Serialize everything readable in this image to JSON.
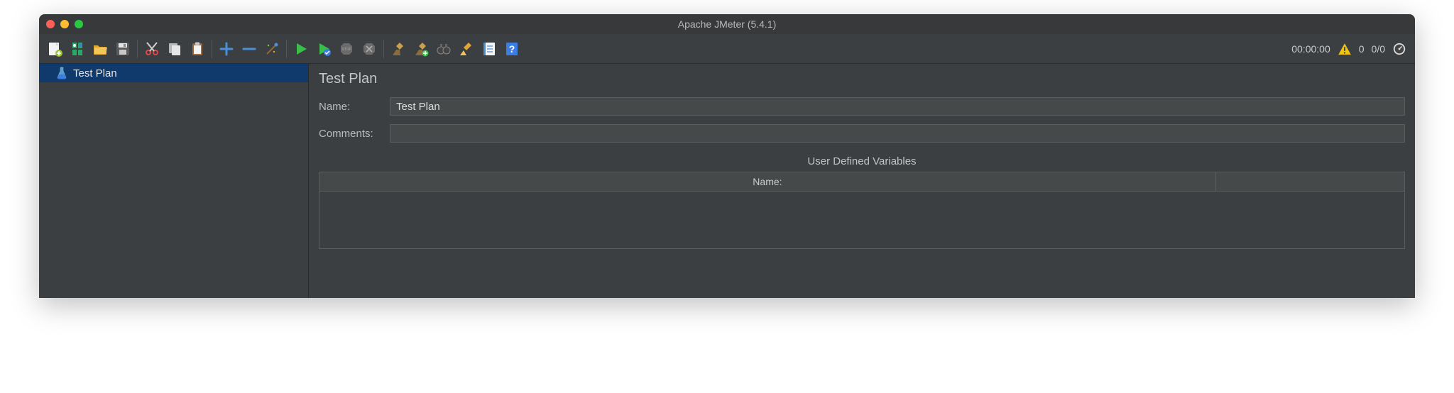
{
  "window": {
    "title": "Apache JMeter (5.4.1)"
  },
  "status": {
    "time": "00:00:00",
    "errors": "0",
    "threads": "0/0"
  },
  "tree": {
    "item_label": "Test Plan"
  },
  "panel": {
    "heading": "Test Plan",
    "name_label": "Name:",
    "name_value": "Test Plan",
    "comments_label": "Comments:",
    "comments_value": "",
    "vars_title": "User Defined Variables",
    "col_name": "Name:",
    "col_value": ""
  }
}
